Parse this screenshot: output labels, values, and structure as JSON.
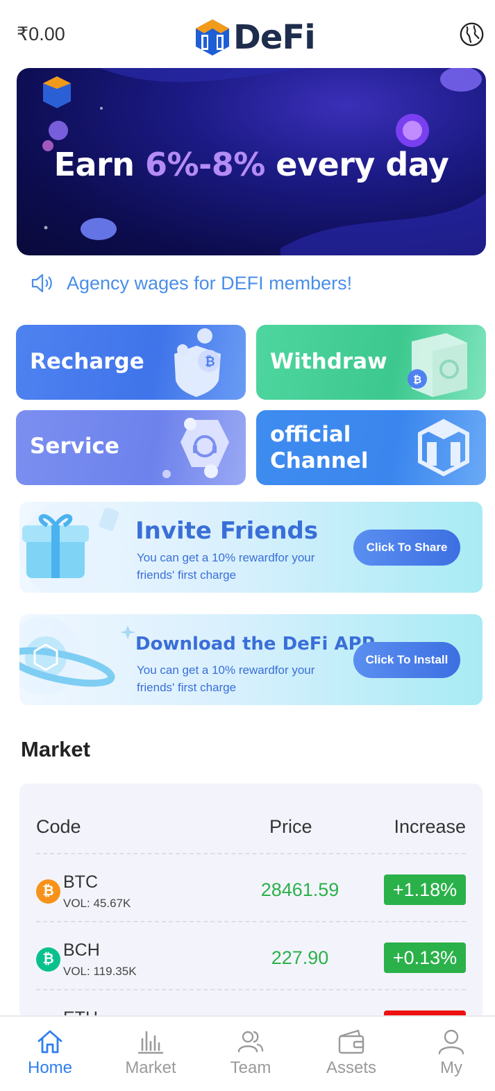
{
  "header": {
    "balance": "₹0.00",
    "logo_text": "DeFi"
  },
  "banner": {
    "text_before": "Earn ",
    "text_highlight": "6%-8%",
    "text_after": " every day"
  },
  "notice": {
    "text": "Agency wages for DEFI members!"
  },
  "actions": [
    {
      "label": "Recharge"
    },
    {
      "label": "Withdraw"
    },
    {
      "label": "Service"
    },
    {
      "label": "official Channel"
    }
  ],
  "promos": [
    {
      "title": "Invite Friends",
      "desc": "You can get a 10% rewardfor your friends' first charge",
      "button": "Click To  Share"
    },
    {
      "title": "Download the DeFi APP",
      "desc": "You can get a 10% rewardfor your friends' first charge",
      "button": "Click To  Install"
    }
  ],
  "market": {
    "title": "Market",
    "headers": {
      "code": "Code",
      "price": "Price",
      "increase": "Increase"
    },
    "rows": [
      {
        "icon": "bitcoin-icon",
        "symbol": "BTC",
        "volume": "VOL: 45.67K",
        "price": "28461.59",
        "change": "+1.18%",
        "color": "#f7931a"
      },
      {
        "icon": "bitcoin-cash-icon",
        "symbol": "BCH",
        "volume": "VOL: 119.35K",
        "price": "227.90",
        "change": "+0.13%",
        "color": "#0ac18e"
      },
      {
        "icon": "ethereum-icon",
        "symbol": "ETH",
        "volume": "",
        "price": "",
        "change": "",
        "color": "#627eea"
      }
    ]
  },
  "tabbar": [
    {
      "label": "Home",
      "icon": "home-icon",
      "active": true
    },
    {
      "label": "Market",
      "icon": "bar-chart-icon"
    },
    {
      "label": "Team",
      "icon": "team-icon"
    },
    {
      "label": "Assets",
      "icon": "wallet-icon"
    },
    {
      "label": "My",
      "icon": "user-icon"
    }
  ],
  "colors": {
    "accent": "#2f7ef0",
    "up": "#2bb14a",
    "down": "#ee1111"
  }
}
